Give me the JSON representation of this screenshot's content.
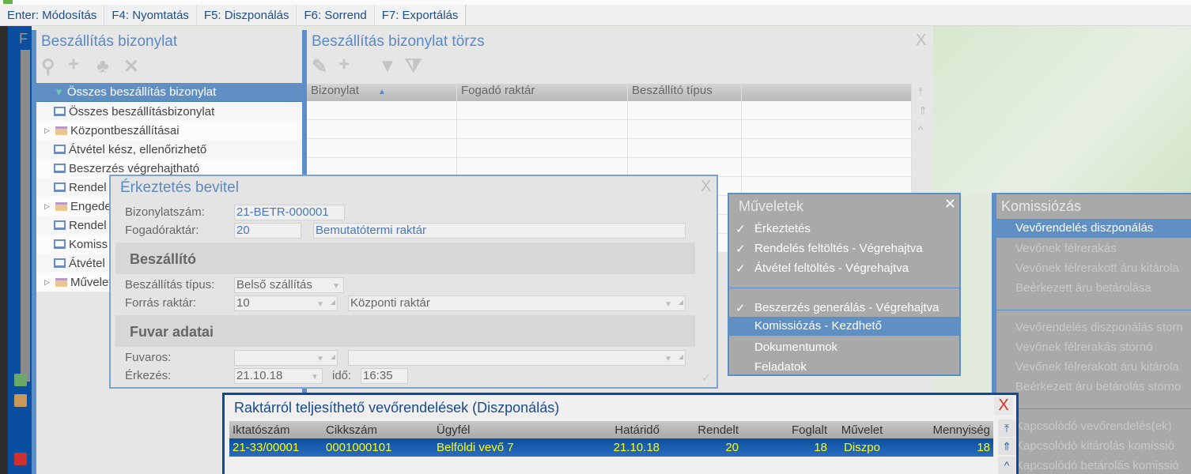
{
  "toolbar": {
    "keys": [
      "Enter: Módosítás",
      "F4: Nyomtatás",
      "F5: Diszponálás",
      "F6: Sorrend",
      "F7: Exportálás"
    ]
  },
  "appbar": {
    "letter": "F"
  },
  "left_panel": {
    "title": "Beszállítás bizonylat",
    "toolbar_icons": [
      "search-icon",
      "plus-icon",
      "tree-icon",
      "pin-off-icon"
    ],
    "items": [
      {
        "label": "Összes beszállítás bizonylat",
        "icon": "filter-icon",
        "selected": true
      },
      {
        "label": "Összes beszállításbizonylat",
        "icon": "monitor-icon"
      },
      {
        "label": "Központbeszállításai",
        "icon": "folder-icon",
        "expandable": true
      },
      {
        "label": "Átvétel kész, ellenőrizhető",
        "icon": "monitor-icon"
      },
      {
        "label": "Beszerzés végrehajtható",
        "icon": "monitor-icon"
      },
      {
        "label": "Rendel",
        "icon": "monitor-icon"
      },
      {
        "label": "Engede",
        "icon": "folder-icon",
        "expandable": true
      },
      {
        "label": "Rendel",
        "icon": "monitor-icon"
      },
      {
        "label": "Komiss",
        "icon": "monitor-icon"
      },
      {
        "label": "Átvétel",
        "icon": "monitor-icon"
      },
      {
        "label": "Művelet",
        "icon": "folder-icon",
        "expandable": true
      }
    ]
  },
  "main_panel": {
    "title": "Beszállítás bizonylat törzs",
    "columns": [
      "Bizonylat",
      "Fogadó raktár",
      "Beszállító típus",
      ""
    ],
    "sort_column": "Bizonylat",
    "close": "X"
  },
  "dialog": {
    "title": "Érkeztetés bevitel",
    "close": "X",
    "bizonylatszam_label": "Bizonylatszám:",
    "bizonylatszam": "21-BETR-000001",
    "fogado_label": "Fogadóraktár:",
    "fogado_code": "20",
    "fogado_name": "Bemutatótermi raktár",
    "section1": "Beszállító",
    "tipus_label": "Beszállítás típus:",
    "tipus": "Belső szállítás",
    "forras_label": "Forrás raktár:",
    "forras_code": "10",
    "forras_name": "Központi raktár",
    "section2": "Fuvar adatai",
    "fuvaros_label": "Fuvaros:",
    "fuvaros_code": "",
    "fuvaros_name": "",
    "erkezes_label": "Érkezés:",
    "erkezes": "21.10.18",
    "ido_label": "idő:",
    "ido": "16:35"
  },
  "menu_muveletek": {
    "title": "Műveletek",
    "close": "✕",
    "items": [
      {
        "label": "Érkeztetés",
        "checked": true
      },
      {
        "label": "Rendelés feltöltés - Végrehajtva",
        "checked": true
      },
      {
        "label": "Átvétel feltöltés - Végrehajtva",
        "checked": true
      },
      {
        "label": "Beszerzés generálás - Végrehajtva",
        "checked": true
      },
      {
        "label": "Komissiózás - Kezdhető",
        "selected": true
      },
      {
        "label": "Dokumentumok"
      },
      {
        "label": "Feladatok"
      }
    ]
  },
  "menu_komissiozas": {
    "title": "Komissiózás",
    "items": [
      {
        "label": "Vevőrendelés diszponálás",
        "selected": true
      },
      {
        "label": "Vevőnek félrerakás",
        "disabled": true
      },
      {
        "label": "Vevőnek félrerakott áru kitárola",
        "disabled": true
      },
      {
        "label": "Beérkezett áru betárolása",
        "disabled": true
      },
      {
        "label": "Vevőrendelés diszponálás storn",
        "disabled": true
      },
      {
        "label": "Vevőnek félrerakás stornó",
        "disabled": true
      },
      {
        "label": "Vevőnek félrerakott áru kitárola",
        "disabled": true
      },
      {
        "label": "Beérkezett áru betárolás storno",
        "disabled": true
      },
      {
        "label": "Kapcsolódó vevőrendelés(ek)",
        "disabled": true
      },
      {
        "label": "Kapcsolódó kitárolás komissió",
        "disabled": true
      },
      {
        "label": "Kapcsolódó betárolás komissió",
        "disabled": true
      }
    ]
  },
  "orders_window": {
    "title": "Raktárról teljesíthető vevőrendelések (Diszponálás)",
    "close": "X",
    "columns": [
      "Iktatószám",
      "Cikkszám",
      "Ügyfél",
      "Határidő",
      "Rendelt",
      "Foglalt",
      "Művelet",
      "Mennyiség"
    ],
    "rows": [
      [
        "21-33/00001",
        "0001000101",
        "Belföldi vevő 7",
        "21.10.18",
        "20",
        "18",
        "Diszpo",
        "18"
      ]
    ]
  },
  "colors": {
    "accent": "#5f8fc3",
    "selected_row_text": "#ffff00",
    "close_red": "#d03020"
  }
}
